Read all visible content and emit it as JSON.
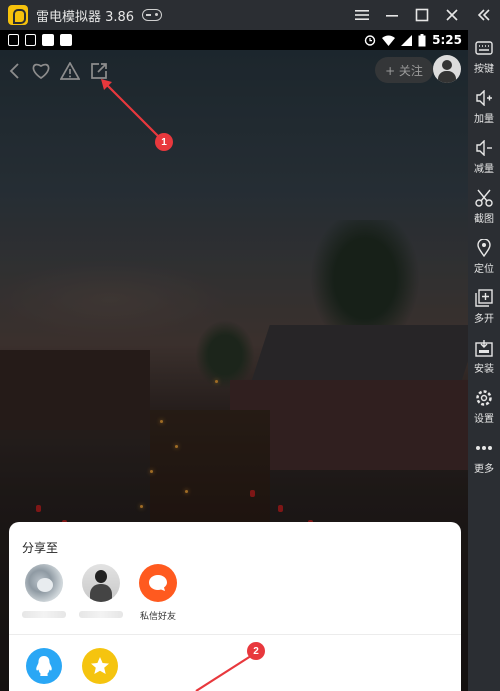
{
  "emulator": {
    "title": "雷电模拟器 3.86",
    "controls": [
      "menu-icon",
      "minimize-icon",
      "maximize-icon",
      "close-icon"
    ],
    "collapse_icon": "double-chevron-left-icon"
  },
  "status_bar": {
    "time": "5:25"
  },
  "video_top": {
    "follow_label": "+ 关注"
  },
  "sidebar": {
    "items": [
      {
        "label": "按键",
        "icon": "keyboard-icon"
      },
      {
        "label": "加量",
        "icon": "volume-up-icon"
      },
      {
        "label": "减量",
        "icon": "volume-down-icon"
      },
      {
        "label": "截图",
        "icon": "scissors-icon"
      },
      {
        "label": "定位",
        "icon": "location-icon"
      },
      {
        "label": "多开",
        "icon": "multi-window-icon"
      },
      {
        "label": "安装",
        "icon": "apk-install-icon"
      },
      {
        "label": "设置",
        "icon": "gear-icon"
      },
      {
        "label": "更多",
        "icon": "more-icon"
      }
    ]
  },
  "share_sheet": {
    "title": "分享至",
    "contacts": [
      {
        "name": "",
        "avatar": "cat-avatar"
      },
      {
        "name": "",
        "avatar": "person-avatar"
      },
      {
        "name": "私信好友",
        "avatar": "message-icon"
      }
    ],
    "apps": [
      {
        "icon": "qq-icon",
        "color": "#2aa7f5"
      },
      {
        "icon": "qzone-star-icon",
        "color": "#f5c40f"
      }
    ]
  },
  "annotations": [
    {
      "label": "1"
    },
    {
      "label": "2"
    }
  ],
  "colors": {
    "accent_orange": "#ff5a1f",
    "badge_red": "#e8383d",
    "emulator_chrome": "#2b2e33"
  }
}
